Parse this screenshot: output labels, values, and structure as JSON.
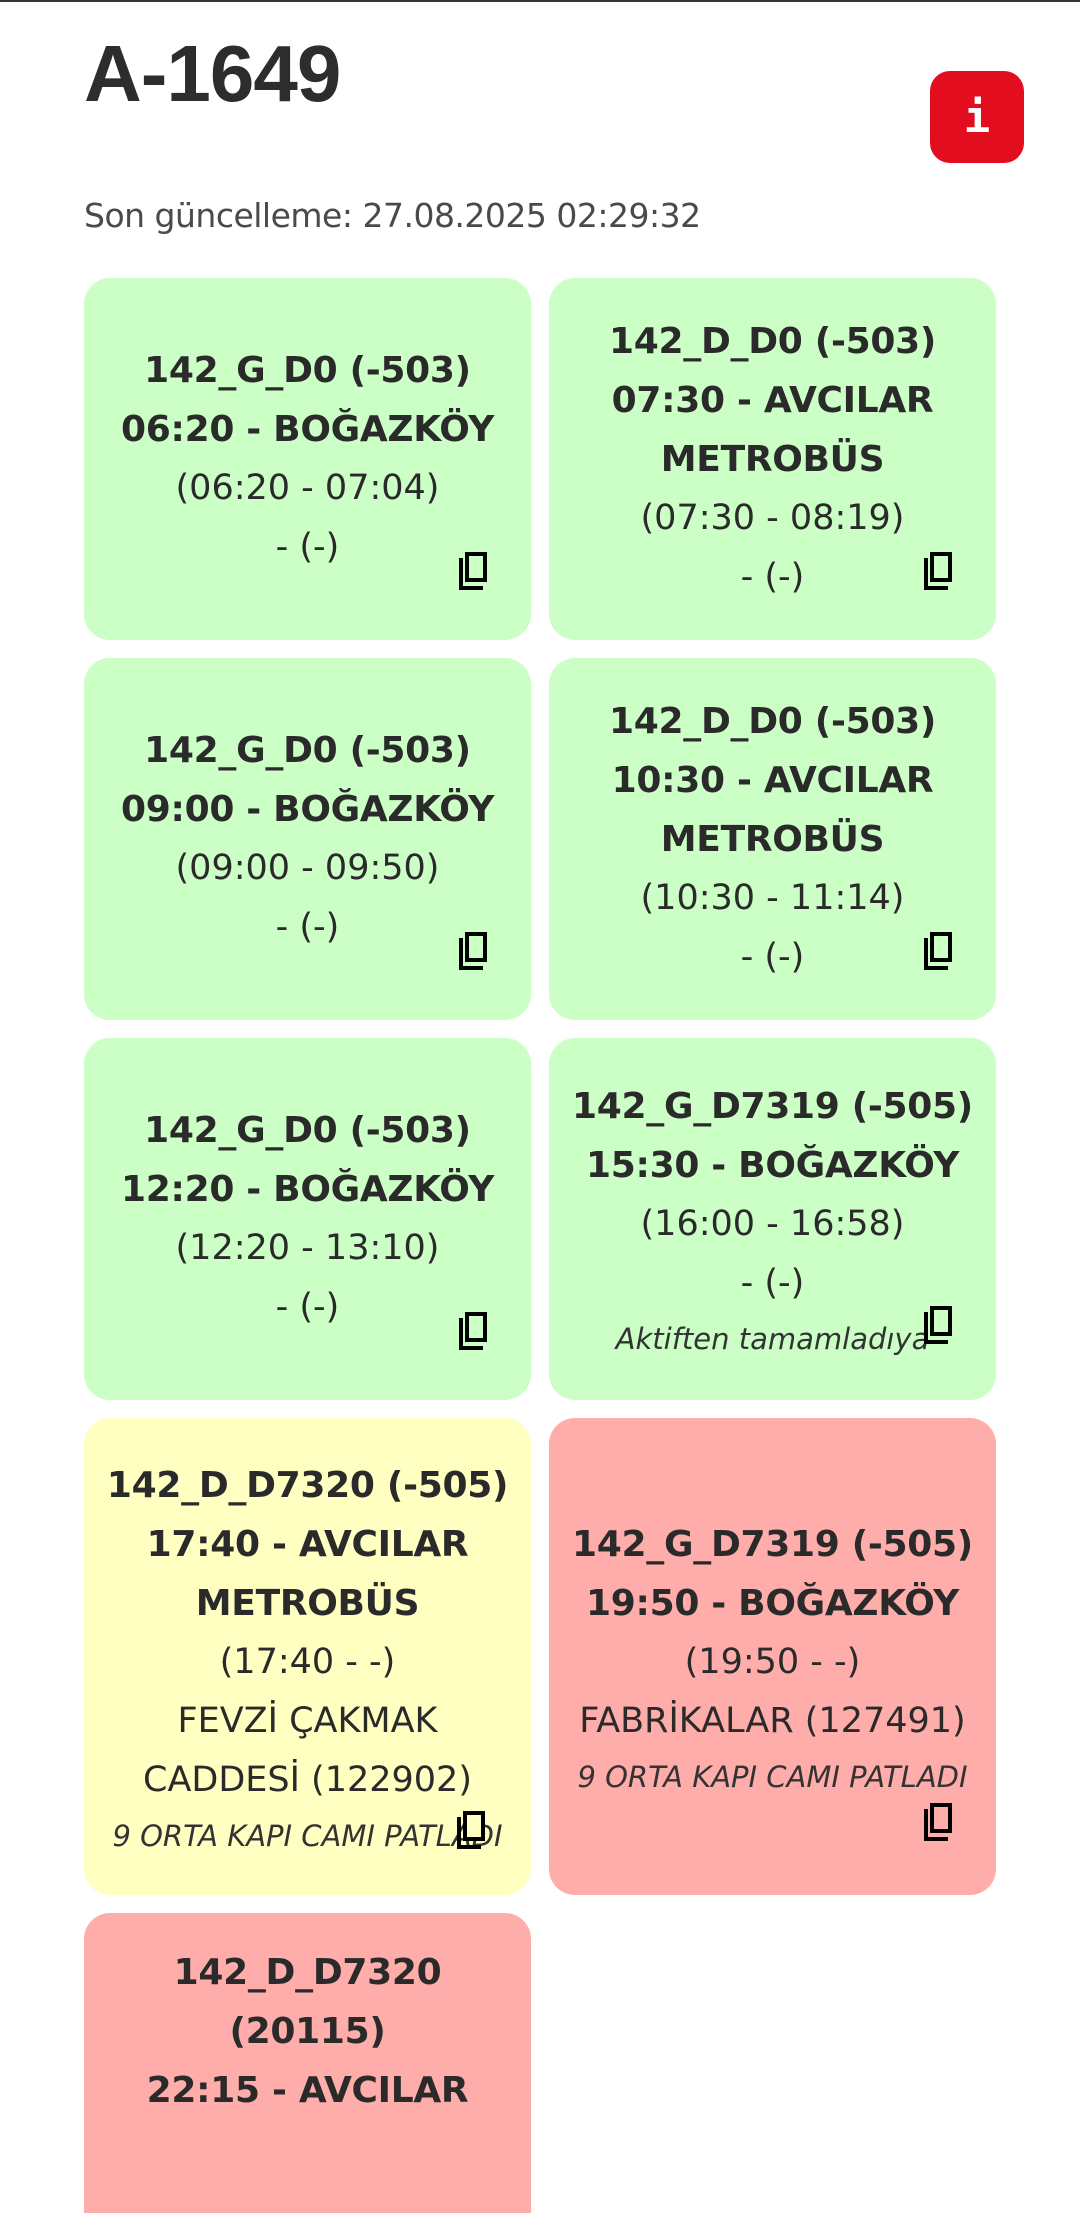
{
  "header": {
    "vehicle_id": "A-1649",
    "info_button_label": "i",
    "last_update": "Son güncelleme: 27.08.2025 02:29:32"
  },
  "trips": [
    {
      "color": "#ccffc6",
      "status": "green",
      "line_code": "142_G_D0 (-503)",
      "departure": "06:20 - BOĞAZKÖY",
      "time_range": "(06:20 - 07:04)",
      "stop": "- (-)",
      "note": ""
    },
    {
      "color": "#ccffc6",
      "status": "green",
      "line_code": "142_D_D0 (-503)",
      "departure": "07:30 - AVCILAR METROBÜS",
      "time_range": "(07:30 - 08:19)",
      "stop": "- (-)",
      "note": ""
    },
    {
      "color": "#ccffc6",
      "status": "green",
      "line_code": "142_G_D0 (-503)",
      "departure": "09:00 - BOĞAZKÖY",
      "time_range": "(09:00 - 09:50)",
      "stop": "- (-)",
      "note": ""
    },
    {
      "color": "#ccffc6",
      "status": "green",
      "line_code": "142_D_D0 (-503)",
      "departure": "10:30 - AVCILAR METROBÜS",
      "time_range": "(10:30 - 11:14)",
      "stop": "- (-)",
      "note": ""
    },
    {
      "color": "#ccffc6",
      "status": "green",
      "line_code": "142_G_D0 (-503)",
      "departure": "12:20 - BOĞAZKÖY",
      "time_range": "(12:20 - 13:10)",
      "stop": "- (-)",
      "note": ""
    },
    {
      "color": "#ccffc6",
      "status": "green",
      "line_code": "142_G_D7319 (-505)",
      "departure": "15:30 - BOĞAZKÖY",
      "time_range": "(16:00 - 16:58)",
      "stop": "- (-)",
      "note": "Aktiften tamamladıya"
    },
    {
      "color": "#feffc0",
      "status": "yellow",
      "line_code": "142_D_D7320 (-505)",
      "departure": "17:40 - AVCILAR METROBÜS",
      "time_range": "(17:40 - -)",
      "stop": "FEVZİ ÇAKMAK CADDESİ (122902)",
      "note": "9 ORTA KAPI CAMI PATLADI"
    },
    {
      "color": "#ffadab",
      "status": "red",
      "line_code": "142_G_D7319 (-505)",
      "departure": "19:50 - BOĞAZKÖY",
      "time_range": "(19:50 - -)",
      "stop": "FABRİKALAR (127491)",
      "note": "9 ORTA KAPI CAMI PATLADI"
    },
    {
      "color": "#ffadab",
      "status": "red",
      "line_code": "142_D_D7320 (20115)",
      "departure": "22:15 - AVCILAR",
      "time_range": "",
      "stop": "",
      "note": ""
    }
  ],
  "icons": {
    "copy": "copy-icon",
    "info": "info-icon"
  }
}
